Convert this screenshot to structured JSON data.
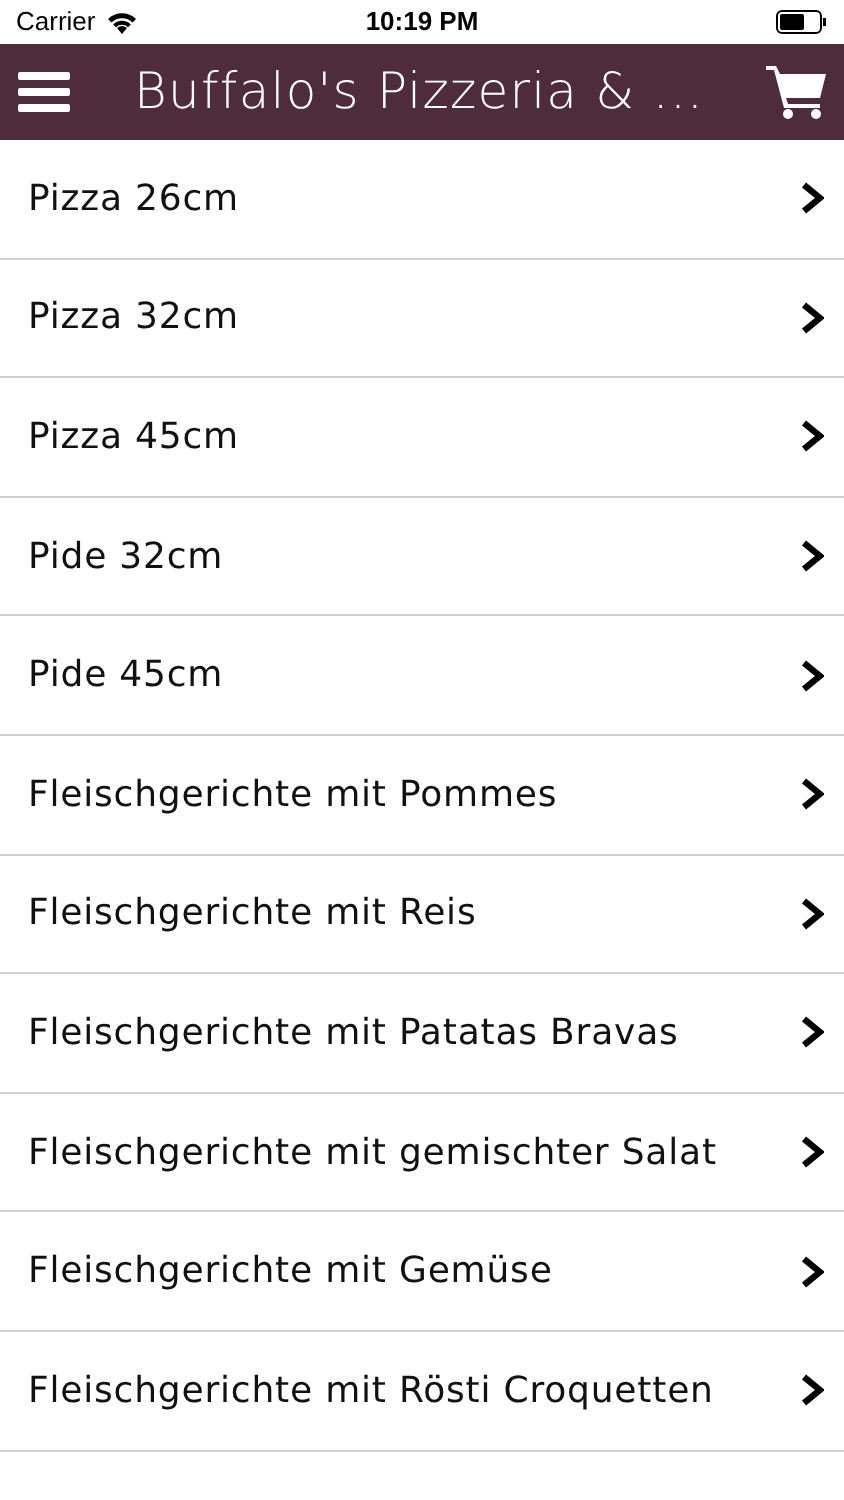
{
  "status_bar": {
    "carrier": "Carrier",
    "time": "10:19 PM"
  },
  "header": {
    "title": "Buffalo's Pizzeria & ..."
  },
  "categories": [
    {
      "label": "Pizza 26cm"
    },
    {
      "label": "Pizza 32cm"
    },
    {
      "label": "Pizza 45cm"
    },
    {
      "label": "Pide 32cm"
    },
    {
      "label": "Pide 45cm"
    },
    {
      "label": "Fleischgerichte mit Pommes"
    },
    {
      "label": "Fleischgerichte mit Reis"
    },
    {
      "label": "Fleischgerichte mit Patatas Bravas"
    },
    {
      "label": "Fleischgerichte mit gemischter Salat"
    },
    {
      "label": "Fleischgerichte mit Gemüse"
    },
    {
      "label": "Fleischgerichte mit Rösti Croquetten"
    }
  ]
}
